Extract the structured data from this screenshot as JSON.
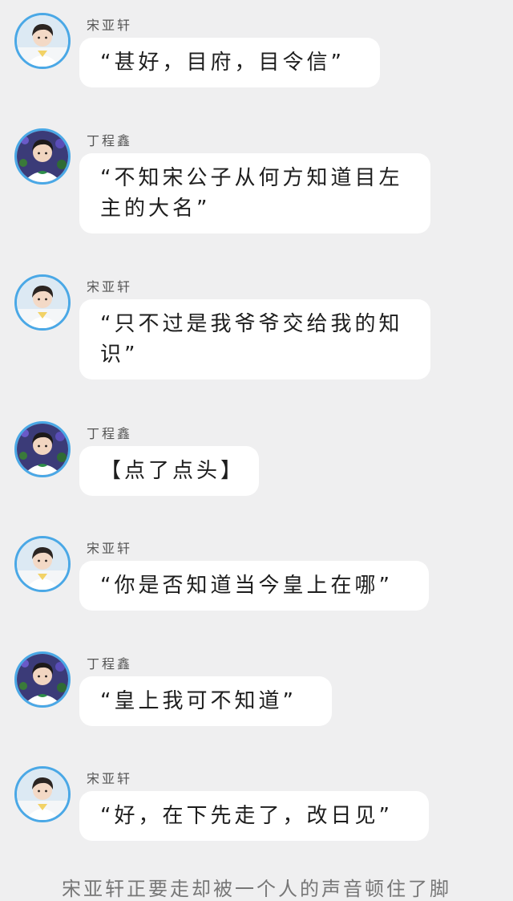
{
  "messages": [
    {
      "speaker": "宋亚轩",
      "avatar": "avatar-songyaxuan-icon",
      "text": "“甚好，目府，目令信”"
    },
    {
      "speaker": "丁程鑫",
      "avatar": "avatar-dingchengxin-icon",
      "text": "“不知宋公子从何方知道目左主的大名”"
    },
    {
      "speaker": "宋亚轩",
      "avatar": "avatar-songyaxuan-icon",
      "text": "“只不过是我爷爷交给我的知识”"
    },
    {
      "speaker": "丁程鑫",
      "avatar": "avatar-dingchengxin-icon",
      "text": "【点了点头】"
    },
    {
      "speaker": "宋亚轩",
      "avatar": "avatar-songyaxuan-icon",
      "text": "“你是否知道当今皇上在哪”"
    },
    {
      "speaker": "丁程鑫",
      "avatar": "avatar-dingchengxin-icon",
      "text": "“皇上我可不知道”"
    },
    {
      "speaker": "宋亚轩",
      "avatar": "avatar-songyaxuan-icon",
      "text": "“好，在下先走了，改日见”"
    }
  ],
  "narration": "宋亚轩正要走却被一个人的声音顿住了脚",
  "colors": {
    "background": "#efeff0",
    "bubble": "#ffffff",
    "avatar_ring": "#4aa8e6"
  }
}
